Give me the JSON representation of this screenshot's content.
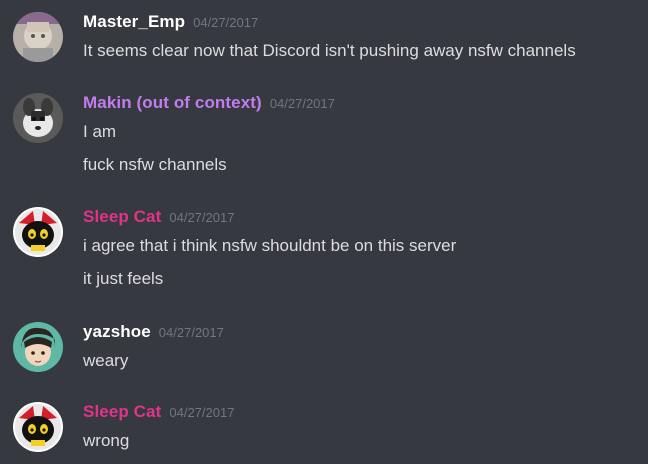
{
  "messages": [
    {
      "author": "Master_Emp",
      "author_color": "#ffffff",
      "avatar": "master-emp-avatar",
      "timestamp": "04/27/2017",
      "lines": [
        "It seems clear now that Discord isn't pushing away nsfw channels"
      ]
    },
    {
      "author": "Makin (out of context)",
      "author_color": "#c27cf0",
      "avatar": "makin-avatar",
      "timestamp": "04/27/2017",
      "lines": [
        "I am",
        "fuck nsfw channels"
      ]
    },
    {
      "author": "Sleep Cat",
      "author_color": "#e0338a",
      "avatar": "sleep-cat-avatar",
      "timestamp": "04/27/2017",
      "lines": [
        "i agree that i think nsfw shouldnt be on this server",
        "it just feels"
      ]
    },
    {
      "author": "yazshoe",
      "author_color": "#ffffff",
      "avatar": "yazshoe-avatar",
      "timestamp": "04/27/2017",
      "lines": [
        "weary"
      ]
    },
    {
      "author": "Sleep Cat",
      "author_color": "#e0338a",
      "avatar": "sleep-cat-avatar",
      "timestamp": "04/27/2017",
      "lines": [
        "wrong"
      ]
    }
  ]
}
